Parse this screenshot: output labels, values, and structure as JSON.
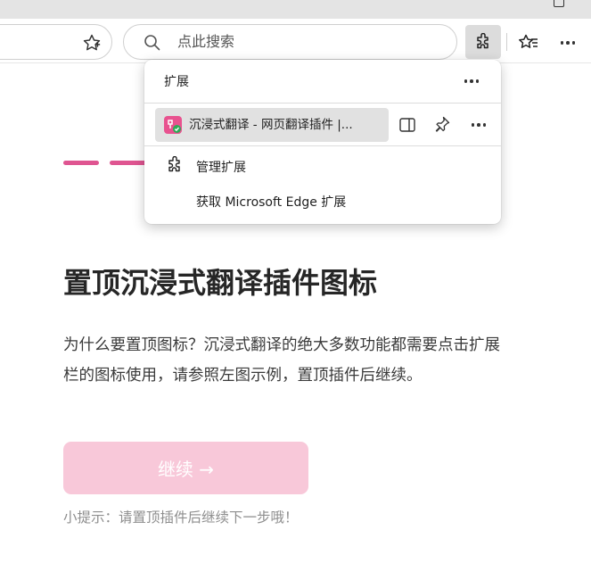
{
  "browser": {
    "search_placeholder": "点此搜索",
    "icons": [
      "star-icon",
      "search-icon",
      "extensions-puzzle-icon",
      "favorites-icon",
      "more-icon"
    ]
  },
  "extensions_popup": {
    "title": "扩展",
    "extension_item": {
      "name": "沉浸式翻译 - 网页翻译插件 |...",
      "logo_color": "#e8528f",
      "check_color": "#2eaa57"
    },
    "manage_label": "管理扩展",
    "get_label": "获取 Microsoft Edge 扩展"
  },
  "page": {
    "accent_color": "#df5591",
    "heading": "置顶沉浸式翻译插件图标",
    "description": "为什么要置顶图标？沉浸式翻译的绝大多数功能都需要点击扩展栏的图标使用，请参照左图示例，置顶插件后继续。",
    "continue_button": "继续 →",
    "continue_button_color": "#f8c8d9",
    "hint": "小提示：请置顶插件后继续下一步哦！"
  }
}
